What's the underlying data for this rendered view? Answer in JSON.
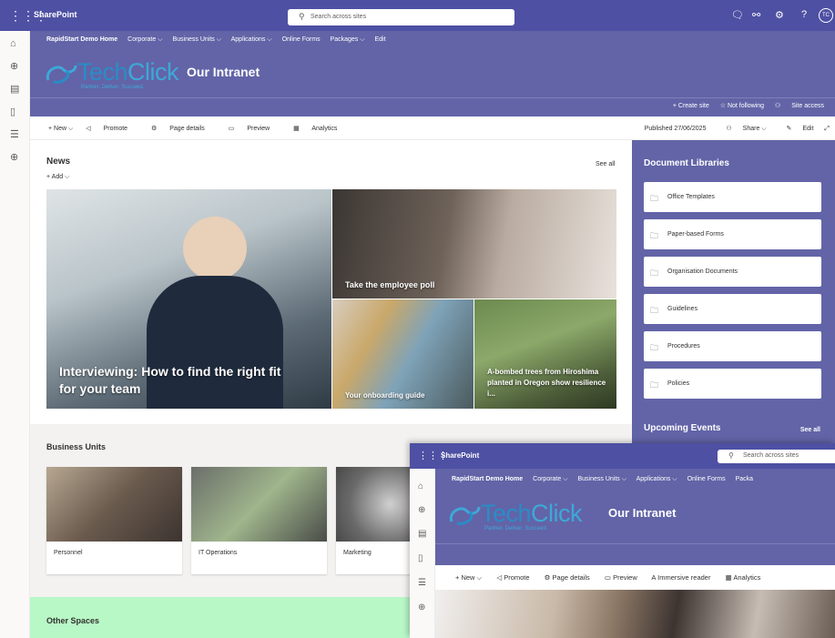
{
  "topbar": {
    "brand": "SharePoint",
    "search_placeholder": "Search across sites",
    "avatar": "TC"
  },
  "hub": {
    "nav": [
      "RapidStart Demo Home",
      "Corporate ⌵",
      "Business Units ⌵",
      "Applications ⌵",
      "Online Forms",
      "Packages ⌵",
      "Edit"
    ],
    "logo_tech": "Tech",
    "logo_click": "Click",
    "logo_tagline": "Partner. Deliver. Succeed.",
    "site_title": "Our Intranet",
    "actions": [
      "+ Create site",
      "☆ Not following",
      "Site access"
    ]
  },
  "command_bar": {
    "left": [
      "+ New ⌵",
      "Promote",
      "Page details",
      "Preview",
      "Analytics"
    ],
    "published": "Published 27/06/2025",
    "share": "Share ⌵",
    "edit": "Edit"
  },
  "news": {
    "title": "News",
    "add": "+ Add ⌵",
    "see_all": "See all",
    "tiles": [
      "Interviewing: How to find the right fit for your team",
      "Take the employee poll",
      "Your onboarding guide",
      "A-bombed trees from Hiroshima planted in Oregon show resilience i..."
    ]
  },
  "business_units": {
    "title": "Business Units",
    "cards": [
      "Personnel",
      "IT Operations",
      "Marketing"
    ]
  },
  "other_spaces": {
    "title": "Other Spaces"
  },
  "doc_libraries": {
    "title": "Document Libraries",
    "items": [
      "Office Templates",
      "Paper-based Forms",
      "Organisation Documents",
      "Guidelines",
      "Procedures",
      "Policies"
    ],
    "events_title": "Upcoming Events",
    "events_see_all": "See all"
  },
  "window2": {
    "brand": "SharePoint",
    "search_placeholder": "Search across sites",
    "nav": [
      "RapidStart Demo Home",
      "Corporate ⌵",
      "Business Units ⌵",
      "Applications ⌵",
      "Online Forms",
      "Packa"
    ],
    "logo_tech": "Tech",
    "logo_click": "Click",
    "logo_tagline": "Partner. Deliver. Succeed.",
    "site_title": "Our Intranet",
    "commands": [
      "+ New ⌵",
      "Promote",
      "Page details",
      "Preview",
      "Immersive reader",
      "Analytics"
    ]
  },
  "colors": {
    "suite_bar": "#4e50a3",
    "hub": "#6264a7",
    "other_spaces": "#b8f7c6",
    "logo": "#3ea8d8"
  }
}
